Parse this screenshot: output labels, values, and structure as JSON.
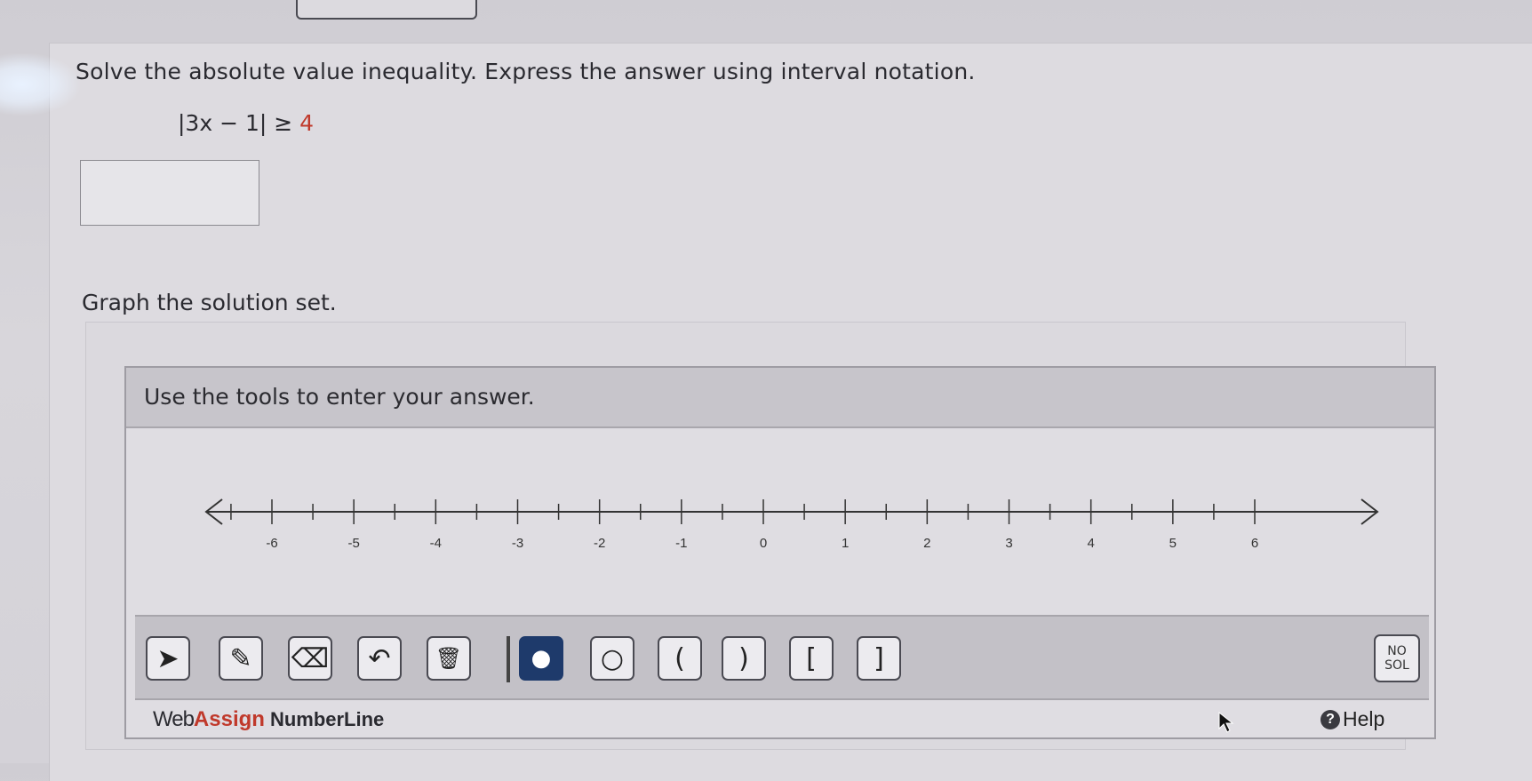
{
  "question": {
    "prompt": "Solve the absolute value inequality. Express the answer using interval notation.",
    "inequality_lhs": "|3x − 1| ≥ ",
    "inequality_rhs": "4",
    "answer_value": ""
  },
  "graph_prompt": "Graph the solution set.",
  "widget": {
    "header": "Use the tools to enter your answer.",
    "numberline": {
      "min": -6,
      "max": 6,
      "major_step": 1,
      "minor_step": 0.5,
      "tick_labels": [
        "-6",
        "-5",
        "-4",
        "-3",
        "-2",
        "-1",
        "0",
        "1",
        "2",
        "3",
        "4",
        "5",
        "6"
      ]
    },
    "tools": [
      {
        "name": "pointer-tool",
        "icon": "pointer-icon",
        "glyph": "➤"
      },
      {
        "name": "pencil-tool",
        "icon": "pencil-icon",
        "glyph": "✎"
      },
      {
        "name": "eraser-tool",
        "icon": "eraser-icon",
        "glyph": "⌫"
      },
      {
        "name": "undo-tool",
        "icon": "undo-icon",
        "glyph": "↶"
      },
      {
        "name": "trash-tool",
        "icon": "trash-icon",
        "glyph": "🗑"
      },
      {
        "name": "closed-dot-tool",
        "icon": "filled-circle-icon",
        "glyph": "●"
      },
      {
        "name": "open-dot-tool",
        "icon": "open-circle-icon",
        "glyph": "○"
      },
      {
        "name": "open-paren-left-tool",
        "icon": "left-paren-icon",
        "glyph": "("
      },
      {
        "name": "open-paren-right-tool",
        "icon": "right-paren-icon",
        "glyph": ")"
      },
      {
        "name": "bracket-left-tool",
        "icon": "left-bracket-icon",
        "glyph": "["
      },
      {
        "name": "bracket-right-tool",
        "icon": "right-bracket-icon",
        "glyph": "]"
      }
    ],
    "nosol_line1": "NO",
    "nosol_line2": "SOL",
    "brand_web": "Web",
    "brand_assign": "Assign",
    "brand_product": "NumberLine",
    "help_label": "Help",
    "help_icon": "?"
  },
  "colors": {
    "accent_red": "#c0392b",
    "selected_tool": "#1e3a6b"
  }
}
